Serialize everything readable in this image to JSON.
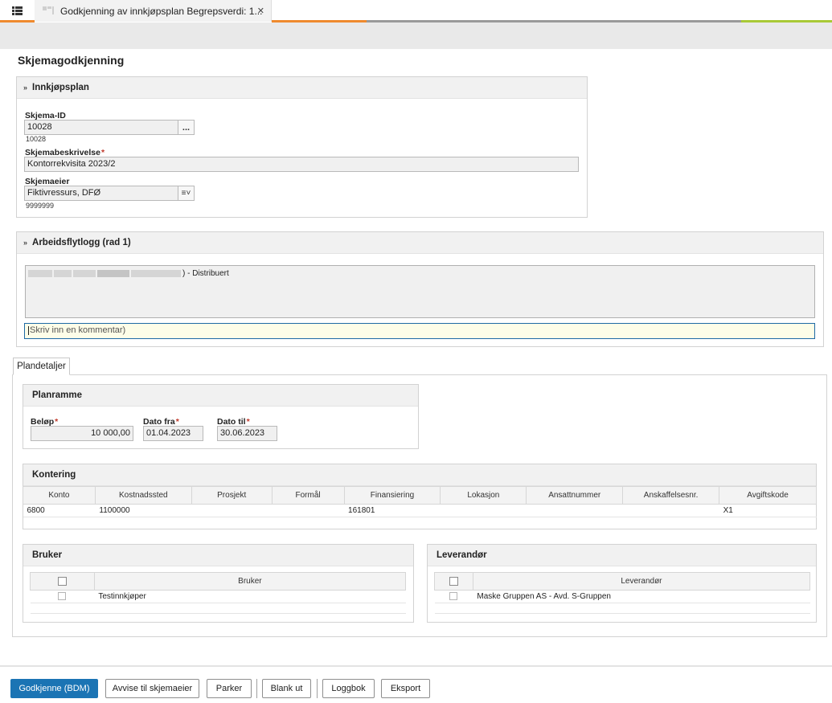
{
  "tab": {
    "title": "Godkjenning av innkjøpsplan Begrepsverdi: 1...",
    "close": "✕"
  },
  "colors": {
    "accent_orange": "#ef8a2e",
    "accent_gray": "#9a9a9a",
    "accent_green": "#a9c937",
    "primary_button": "#1b74b4"
  },
  "page": {
    "title": "Skjemagodkjenning"
  },
  "innkjopsplan": {
    "title": "Innkjøpsplan",
    "skjema_id_label": "Skjema-ID",
    "skjema_id_value": "10028",
    "skjema_id_sub": "10028",
    "lookup_btn": "...",
    "beskrivelse_label": "Skjemabeskrivelse",
    "beskrivelse_value": "Kontorrekvisita 2023/2",
    "eier_label": "Skjemaeier",
    "eier_value": "Fiktivressurs, DFØ",
    "eier_sub": "9999999",
    "eier_dropdown": "≡˅",
    "required_mark": "*"
  },
  "arbeidsflyt": {
    "title": "Arbeidsflytlogg (rad 1)",
    "log_entry": ") - Distribuert",
    "comment_placeholder": "Skriv inn en kommentar)"
  },
  "tabs": {
    "plandetaljer": "Plandetaljer"
  },
  "planramme": {
    "title": "Planramme",
    "belop_label": "Beløp",
    "belop_value": "10 000,00",
    "dato_fra_label": "Dato fra",
    "dato_fra_value": "01.04.2023",
    "dato_til_label": "Dato til",
    "dato_til_value": "30.06.2023"
  },
  "kontering": {
    "title": "Kontering",
    "columns": [
      "Konto",
      "Kostnadssted",
      "Prosjekt",
      "Formål",
      "Finansiering",
      "Lokasjon",
      "Ansattnummer",
      "Anskaffelsesnr.",
      "Avgiftskode"
    ],
    "rows": [
      [
        "6800",
        "1100000",
        "",
        "",
        "161801",
        "",
        "",
        "",
        "X1"
      ]
    ]
  },
  "bruker": {
    "title": "Bruker",
    "column": "Bruker",
    "rows": [
      "Testinnkjøper"
    ]
  },
  "leverandor": {
    "title": "Leverandør",
    "column": "Leverandør",
    "rows": [
      "Maske Gruppen AS - Avd. S-Gruppen"
    ]
  },
  "buttons": {
    "godkjenne": "Godkjenne (BDM)",
    "avvise": "Avvise til skjemaeier",
    "parker": "Parker",
    "blank_ut": "Blank ut",
    "loggbok": "Loggbok",
    "eksport": "Eksport"
  }
}
